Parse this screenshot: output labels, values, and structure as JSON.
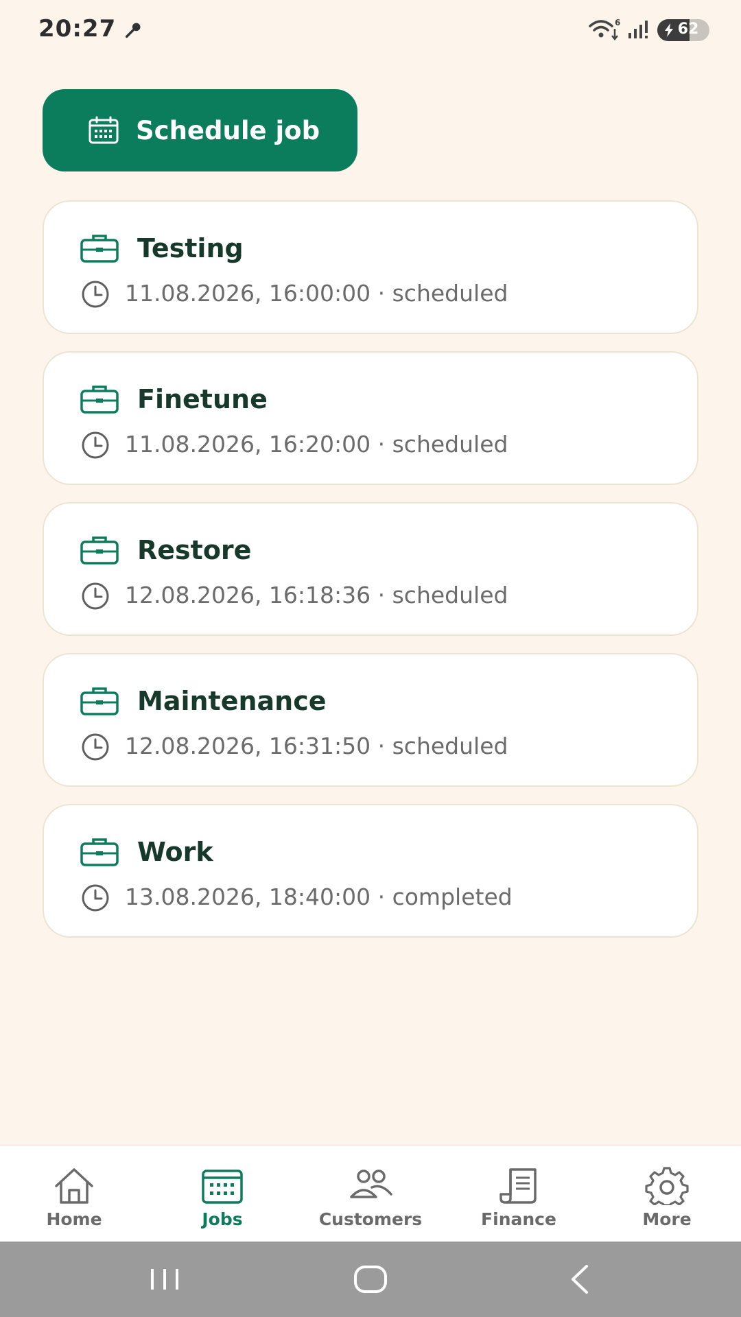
{
  "status_bar": {
    "time": "20:27",
    "battery_level": "62",
    "battery_fraction": 0.62,
    "wifi_label": "6"
  },
  "actions": {
    "schedule_label": "Schedule job",
    "schedule_icon": "calendar-icon"
  },
  "jobs": [
    {
      "title": "Testing",
      "meta": "11.08.2026, 16:00:00 · scheduled"
    },
    {
      "title": "Finetune",
      "meta": "11.08.2026, 16:20:00 · scheduled"
    },
    {
      "title": "Restore",
      "meta": "12.08.2026, 16:18:36 · scheduled"
    },
    {
      "title": "Maintenance",
      "meta": "12.08.2026, 16:31:50 · scheduled"
    },
    {
      "title": "Work",
      "meta": "13.08.2026, 18:40:00 · completed"
    }
  ],
  "nav": {
    "items": [
      {
        "label": "Home",
        "icon": "home-icon"
      },
      {
        "label": "Jobs",
        "icon": "calendar-icon",
        "active": true
      },
      {
        "label": "Customers",
        "icon": "users-icon"
      },
      {
        "label": "Finance",
        "icon": "receipt-icon"
      },
      {
        "label": "More",
        "icon": "gear-icon"
      }
    ]
  },
  "colors": {
    "background": "#fdf5ec",
    "primary": "#0c7d5c",
    "title_text": "#16392c",
    "card_border": "#ece3d3"
  }
}
